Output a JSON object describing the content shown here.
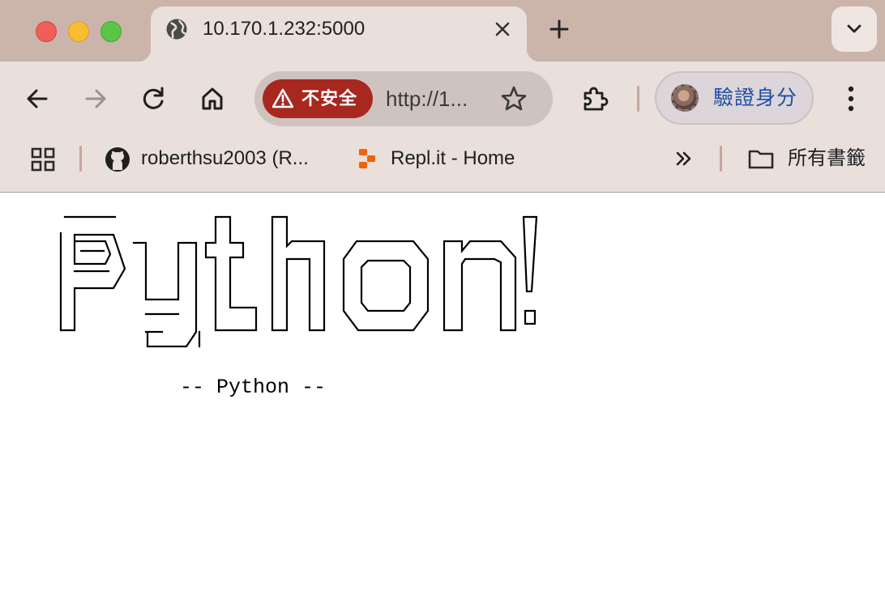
{
  "window": {
    "controls": [
      "close",
      "minimize",
      "zoom"
    ]
  },
  "tab": {
    "title": "10.170.1.232:5000",
    "favicon": "globe-icon",
    "close_icon": "close-icon"
  },
  "tabstrip": {
    "new_tab_icon": "plus-icon",
    "tab_search_icon": "chevron-down-icon"
  },
  "toolbar": {
    "back_icon": "arrow-left-icon",
    "forward_icon": "arrow-right-icon",
    "reload_icon": "reload-icon",
    "home_icon": "home-icon",
    "security_label": "不安全",
    "url": "http://1...",
    "bookmark_star_icon": "star-icon",
    "extensions_icon": "puzzle-icon",
    "profile_label": "驗證身分",
    "menu_icon": "vertical-dots-icon"
  },
  "bookmarks": {
    "apps_icon": "grid-icon",
    "items": [
      {
        "label": "roberthsu2003 (R...",
        "icon": "github-icon"
      },
      {
        "label": "Repl.it - Home",
        "icon": "replit-icon"
      }
    ],
    "overflow_icon": "double-chevron-right-icon",
    "all_bookmarks_label": "所有書籤",
    "all_bookmarks_icon": "folder-icon"
  },
  "page": {
    "caption": "-- Python --"
  },
  "colors": {
    "tabstrip_bg": "#cbb5ab",
    "toolbar_bg": "#e9dfdb",
    "insecure_badge": "#a8281f",
    "profile_text": "#1f4fa3"
  }
}
